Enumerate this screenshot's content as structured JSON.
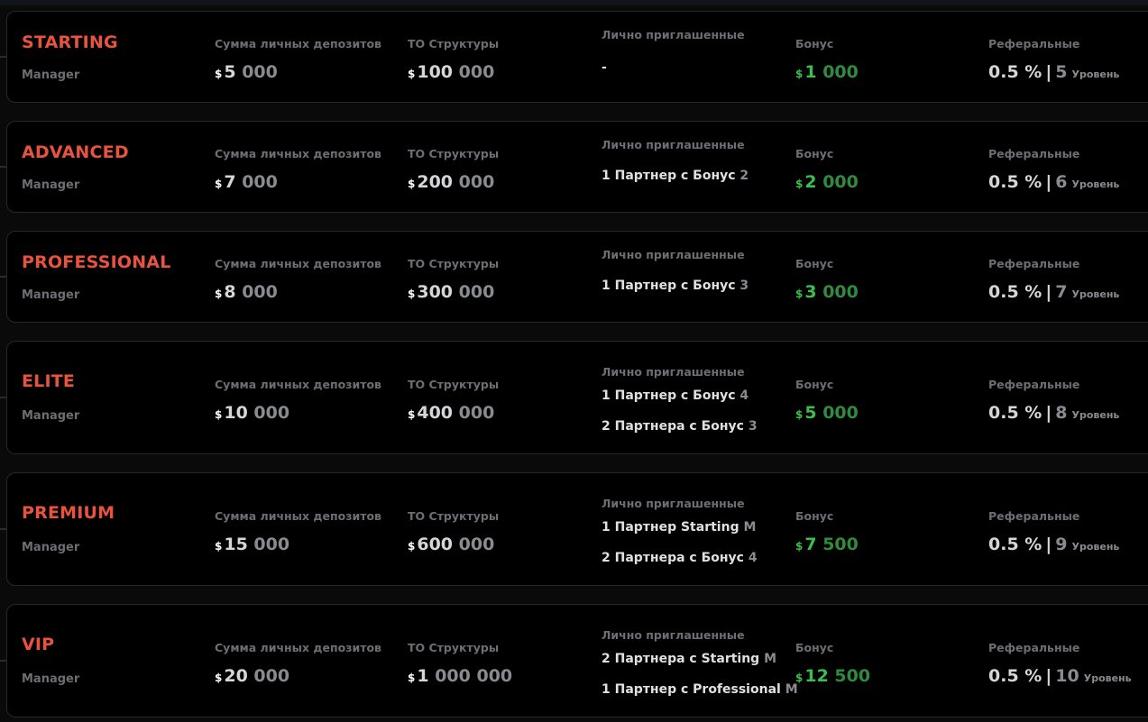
{
  "columns": {
    "deposits": "Сумма личных депозитов",
    "structure": "ТО Структуры",
    "invited": "Лично приглашенные",
    "bonus": "Бонус",
    "referral": "Реферальные"
  },
  "currency": "$",
  "level_word": "Уровень",
  "accent_color": "#e8533f",
  "bonus_color": "#3cbd4f",
  "ranks": [
    {
      "name": "STARTING",
      "sub": "Manager",
      "deposit_lead": "5",
      "deposit_rest": " 000",
      "structure_lead": "100",
      "structure_rest": " 000",
      "invited": [
        {
          "pre": "-",
          "post": ""
        }
      ],
      "bonus_lead": "1",
      "bonus_rest": " 000",
      "ref_pct": "0.5 %",
      "ref_sep": "|",
      "ref_level": "5"
    },
    {
      "name": "ADVANCED",
      "sub": "Manager",
      "deposit_lead": "7",
      "deposit_rest": " 000",
      "structure_lead": "200",
      "structure_rest": " 000",
      "invited": [
        {
          "pre": "1 Партнер с Бонус",
          "post": " 2"
        }
      ],
      "bonus_lead": "2",
      "bonus_rest": " 000",
      "ref_pct": "0.5 %",
      "ref_sep": "|",
      "ref_level": "6"
    },
    {
      "name": "PROFESSIONAL",
      "sub": "Manager",
      "deposit_lead": "8",
      "deposit_rest": " 000",
      "structure_lead": "300",
      "structure_rest": " 000",
      "invited": [
        {
          "pre": "1 Партнер с Бонус",
          "post": " 3"
        }
      ],
      "bonus_lead": "3",
      "bonus_rest": " 000",
      "ref_pct": "0.5 %",
      "ref_sep": "|",
      "ref_level": "7"
    },
    {
      "name": "ELITE",
      "sub": "Manager",
      "deposit_lead": "10",
      "deposit_rest": " 000",
      "structure_lead": "400",
      "structure_rest": " 000",
      "invited": [
        {
          "pre": "1 Партнер с Бонус",
          "post": " 4"
        },
        {
          "pre": "2 Партнера с Бонус",
          "post": " 3"
        }
      ],
      "bonus_lead": "5",
      "bonus_rest": " 000",
      "ref_pct": "0.5 %",
      "ref_sep": "|",
      "ref_level": "8"
    },
    {
      "name": "PREMIUM",
      "sub": "Manager",
      "deposit_lead": "15",
      "deposit_rest": " 000",
      "structure_lead": "600",
      "structure_rest": " 000",
      "invited": [
        {
          "pre": "1 Партнер Starting",
          "post": " M"
        },
        {
          "pre": "2 Партнера с Бонус",
          "post": " 4"
        }
      ],
      "bonus_lead": "7",
      "bonus_rest": " 500",
      "ref_pct": "0.5 %",
      "ref_sep": "|",
      "ref_level": "9"
    },
    {
      "name": "VIP",
      "sub": "Manager",
      "deposit_lead": "20",
      "deposit_rest": " 000",
      "structure_lead": "1",
      "structure_rest": " 000 000",
      "invited": [
        {
          "pre": "2 Партнера с Starting",
          "post": " M"
        },
        {
          "pre": "1 Партнер с Professional",
          "post": " M"
        }
      ],
      "bonus_lead": "12",
      "bonus_rest": " 500",
      "ref_pct": "0.5 %",
      "ref_sep": "|",
      "ref_level": "10"
    }
  ]
}
